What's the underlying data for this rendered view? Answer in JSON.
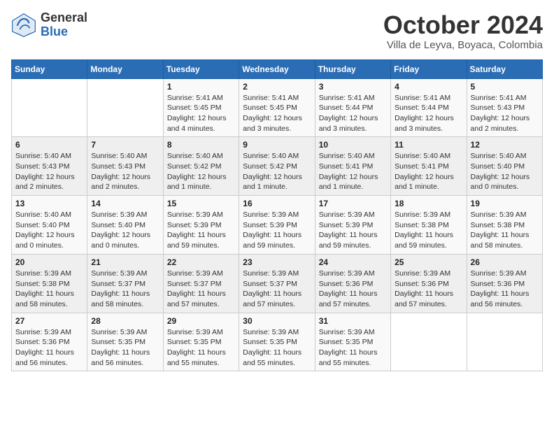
{
  "header": {
    "logo_general": "General",
    "logo_blue": "Blue",
    "month_year": "October 2024",
    "location": "Villa de Leyva, Boyaca, Colombia"
  },
  "days_of_week": [
    "Sunday",
    "Monday",
    "Tuesday",
    "Wednesday",
    "Thursday",
    "Friday",
    "Saturday"
  ],
  "weeks": [
    [
      {
        "day": "",
        "info": ""
      },
      {
        "day": "",
        "info": ""
      },
      {
        "day": "1",
        "info": "Sunrise: 5:41 AM\nSunset: 5:45 PM\nDaylight: 12 hours and 4 minutes."
      },
      {
        "day": "2",
        "info": "Sunrise: 5:41 AM\nSunset: 5:45 PM\nDaylight: 12 hours and 3 minutes."
      },
      {
        "day": "3",
        "info": "Sunrise: 5:41 AM\nSunset: 5:44 PM\nDaylight: 12 hours and 3 minutes."
      },
      {
        "day": "4",
        "info": "Sunrise: 5:41 AM\nSunset: 5:44 PM\nDaylight: 12 hours and 3 minutes."
      },
      {
        "day": "5",
        "info": "Sunrise: 5:41 AM\nSunset: 5:43 PM\nDaylight: 12 hours and 2 minutes."
      }
    ],
    [
      {
        "day": "6",
        "info": "Sunrise: 5:40 AM\nSunset: 5:43 PM\nDaylight: 12 hours and 2 minutes."
      },
      {
        "day": "7",
        "info": "Sunrise: 5:40 AM\nSunset: 5:43 PM\nDaylight: 12 hours and 2 minutes."
      },
      {
        "day": "8",
        "info": "Sunrise: 5:40 AM\nSunset: 5:42 PM\nDaylight: 12 hours and 1 minute."
      },
      {
        "day": "9",
        "info": "Sunrise: 5:40 AM\nSunset: 5:42 PM\nDaylight: 12 hours and 1 minute."
      },
      {
        "day": "10",
        "info": "Sunrise: 5:40 AM\nSunset: 5:41 PM\nDaylight: 12 hours and 1 minute."
      },
      {
        "day": "11",
        "info": "Sunrise: 5:40 AM\nSunset: 5:41 PM\nDaylight: 12 hours and 1 minute."
      },
      {
        "day": "12",
        "info": "Sunrise: 5:40 AM\nSunset: 5:40 PM\nDaylight: 12 hours and 0 minutes."
      }
    ],
    [
      {
        "day": "13",
        "info": "Sunrise: 5:40 AM\nSunset: 5:40 PM\nDaylight: 12 hours and 0 minutes."
      },
      {
        "day": "14",
        "info": "Sunrise: 5:39 AM\nSunset: 5:40 PM\nDaylight: 12 hours and 0 minutes."
      },
      {
        "day": "15",
        "info": "Sunrise: 5:39 AM\nSunset: 5:39 PM\nDaylight: 11 hours and 59 minutes."
      },
      {
        "day": "16",
        "info": "Sunrise: 5:39 AM\nSunset: 5:39 PM\nDaylight: 11 hours and 59 minutes."
      },
      {
        "day": "17",
        "info": "Sunrise: 5:39 AM\nSunset: 5:39 PM\nDaylight: 11 hours and 59 minutes."
      },
      {
        "day": "18",
        "info": "Sunrise: 5:39 AM\nSunset: 5:38 PM\nDaylight: 11 hours and 59 minutes."
      },
      {
        "day": "19",
        "info": "Sunrise: 5:39 AM\nSunset: 5:38 PM\nDaylight: 11 hours and 58 minutes."
      }
    ],
    [
      {
        "day": "20",
        "info": "Sunrise: 5:39 AM\nSunset: 5:38 PM\nDaylight: 11 hours and 58 minutes."
      },
      {
        "day": "21",
        "info": "Sunrise: 5:39 AM\nSunset: 5:37 PM\nDaylight: 11 hours and 58 minutes."
      },
      {
        "day": "22",
        "info": "Sunrise: 5:39 AM\nSunset: 5:37 PM\nDaylight: 11 hours and 57 minutes."
      },
      {
        "day": "23",
        "info": "Sunrise: 5:39 AM\nSunset: 5:37 PM\nDaylight: 11 hours and 57 minutes."
      },
      {
        "day": "24",
        "info": "Sunrise: 5:39 AM\nSunset: 5:36 PM\nDaylight: 11 hours and 57 minutes."
      },
      {
        "day": "25",
        "info": "Sunrise: 5:39 AM\nSunset: 5:36 PM\nDaylight: 11 hours and 57 minutes."
      },
      {
        "day": "26",
        "info": "Sunrise: 5:39 AM\nSunset: 5:36 PM\nDaylight: 11 hours and 56 minutes."
      }
    ],
    [
      {
        "day": "27",
        "info": "Sunrise: 5:39 AM\nSunset: 5:36 PM\nDaylight: 11 hours and 56 minutes."
      },
      {
        "day": "28",
        "info": "Sunrise: 5:39 AM\nSunset: 5:35 PM\nDaylight: 11 hours and 56 minutes."
      },
      {
        "day": "29",
        "info": "Sunrise: 5:39 AM\nSunset: 5:35 PM\nDaylight: 11 hours and 55 minutes."
      },
      {
        "day": "30",
        "info": "Sunrise: 5:39 AM\nSunset: 5:35 PM\nDaylight: 11 hours and 55 minutes."
      },
      {
        "day": "31",
        "info": "Sunrise: 5:39 AM\nSunset: 5:35 PM\nDaylight: 11 hours and 55 minutes."
      },
      {
        "day": "",
        "info": ""
      },
      {
        "day": "",
        "info": ""
      }
    ]
  ]
}
